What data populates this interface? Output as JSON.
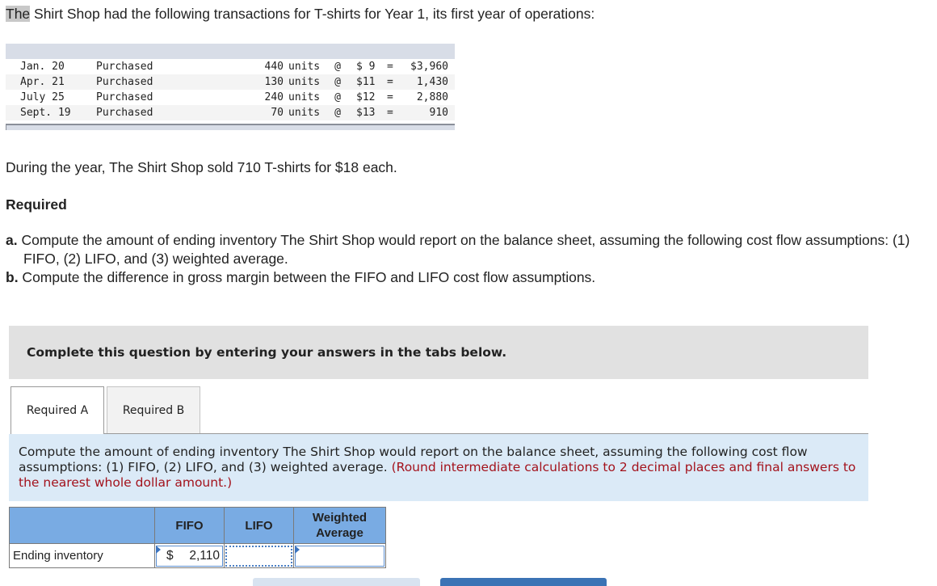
{
  "intro": {
    "highlighted": "The",
    "rest": " Shirt Shop had the following transactions for T-shirts for Year 1, its first year of operations:"
  },
  "transactions": [
    {
      "date": "Jan. 20",
      "description": "Purchased",
      "units": "440",
      "unit_label": "units",
      "at": "@",
      "price": "$ 9",
      "eq": "=",
      "total": "$3,960"
    },
    {
      "date": "Apr. 21",
      "description": "Purchased",
      "units": "130",
      "unit_label": "units",
      "at": "@",
      "price": "$11",
      "eq": "=",
      "total": "1,430"
    },
    {
      "date": "July 25",
      "description": "Purchased",
      "units": "240",
      "unit_label": "units",
      "at": "@",
      "price": "$12",
      "eq": "=",
      "total": "2,880"
    },
    {
      "date": "Sept. 19",
      "description": "Purchased",
      "units": "70",
      "unit_label": "units",
      "at": "@",
      "price": "$13",
      "eq": "=",
      "total": "910"
    }
  ],
  "sold_text": "During the year, The Shirt Shop sold 710 T-shirts for $18 each.",
  "required_heading": "Required",
  "requirements": [
    {
      "letter": "a.",
      "text": " Compute the amount of ending inventory The Shirt Shop would report on the balance sheet, assuming the following cost flow assumptions: (1) FIFO, (2) LIFO, and (3) weighted average."
    },
    {
      "letter": "b.",
      "text": " Compute the difference in gross margin between the FIFO and LIFO cost flow assumptions."
    }
  ],
  "instruction": "Complete this question by entering your answers in the tabs below.",
  "tabs": [
    {
      "label": "Required A",
      "active": true
    },
    {
      "label": "Required B",
      "active": false
    }
  ],
  "panel": {
    "text": "Compute the amount of ending inventory The Shirt Shop would report on the balance sheet, assuming the following cost flow assumptions: (1) FIFO, (2) LIFO, and (3) weighted average. ",
    "note": "(Round intermediate calculations to 2 decimal places and final answers to the nearest whole dollar amount.)"
  },
  "answer_table": {
    "headers": [
      "",
      "FIFO",
      "LIFO",
      "Weighted Average"
    ],
    "row_label": "Ending inventory",
    "fifo": {
      "currency": "$",
      "value": "2,110"
    },
    "lifo": {
      "value": ""
    },
    "weighted_average": {
      "value": ""
    }
  }
}
